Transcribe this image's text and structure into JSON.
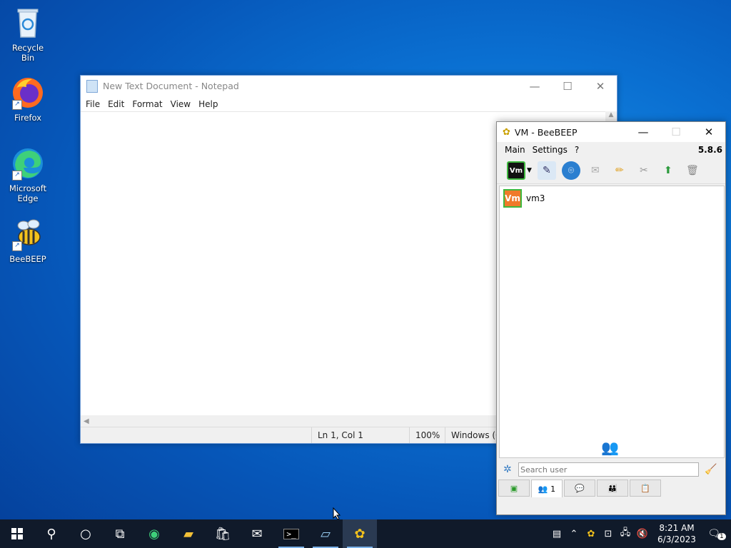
{
  "desktop": {
    "icons": [
      {
        "label": "Recycle Bin"
      },
      {
        "label": "Firefox"
      },
      {
        "label": "Microsoft Edge"
      },
      {
        "label": "BeeBEEP"
      }
    ]
  },
  "notepad": {
    "title": "New Text Document - Notepad",
    "menu": [
      "File",
      "Edit",
      "Format",
      "View",
      "Help"
    ],
    "status": {
      "position": "Ln 1, Col 1",
      "zoom": "100%",
      "encoding": "Windows (C"
    }
  },
  "beebeep": {
    "title": "VM - BeeBEEP",
    "menu": [
      "Main",
      "Settings",
      "?"
    ],
    "version": "5.8.6",
    "user": {
      "avatar_text": "Vm",
      "name": "vm3"
    },
    "search_placeholder": "Search user",
    "tab_count": "1"
  },
  "taskbar": {
    "time": "8:21 AM",
    "date": "6/3/2023",
    "notification_count": "1"
  }
}
